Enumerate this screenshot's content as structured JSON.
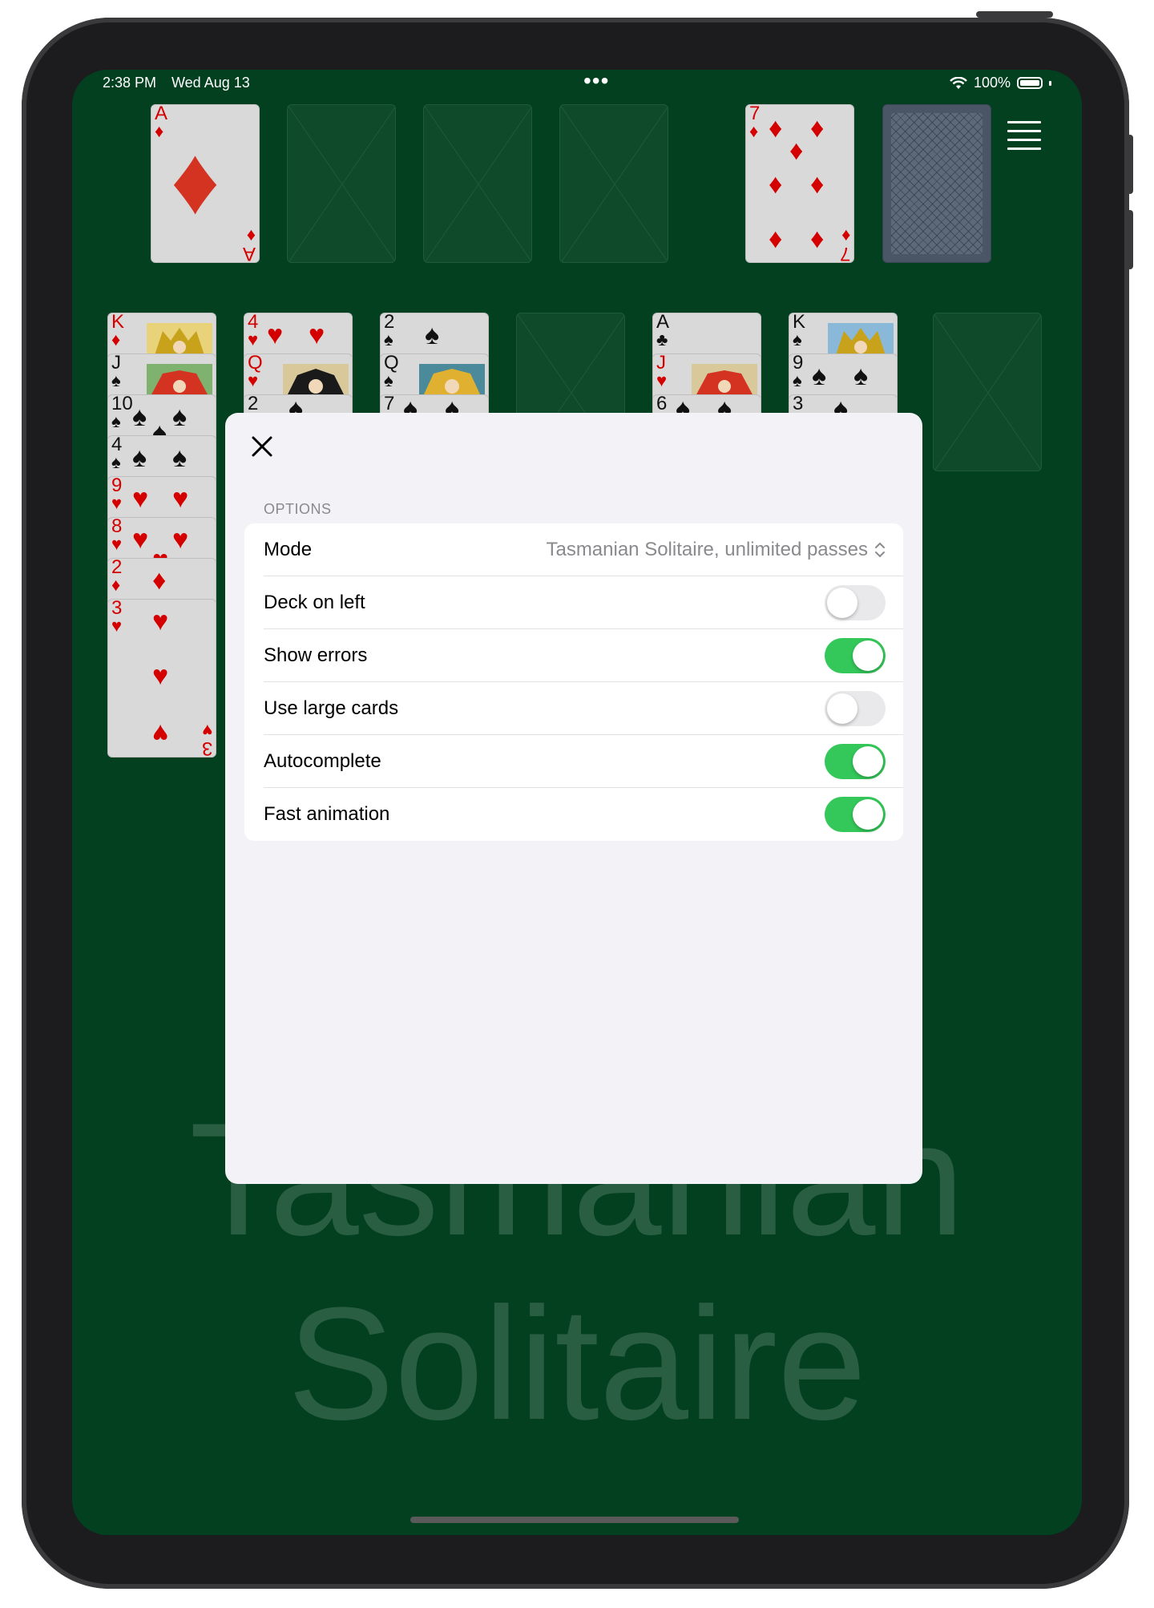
{
  "status_bar": {
    "time": "2:38 PM",
    "date": "Wed Aug 13",
    "more_dots": "•••",
    "battery": "100%"
  },
  "board": {
    "foundation": [
      {
        "rank": "A",
        "suit": "♦",
        "color": "red"
      },
      {
        "empty": true
      },
      {
        "empty": true
      },
      {
        "empty": true
      }
    ],
    "waste_card": {
      "rank": "7",
      "suit": "♦",
      "color": "red"
    },
    "columns": [
      {
        "cards": [
          "K♦",
          "J♠",
          "10♠",
          "4♠",
          "9♥",
          "8♥",
          "2♦",
          "3♥"
        ]
      },
      {
        "cards": [
          "4♥",
          "Q♥",
          "2♠"
        ]
      },
      {
        "cards": [
          "2♠",
          "Q♠",
          "7♠"
        ]
      },
      {
        "cards": []
      },
      {
        "cards": [
          "A♣",
          "J♥",
          "6♠"
        ]
      },
      {
        "cards": [
          "K♠",
          "9♠",
          "3♠"
        ]
      },
      {
        "cards": []
      }
    ]
  },
  "watermark": {
    "line1": "Tasmanian",
    "line2": "Solitaire"
  },
  "options_modal": {
    "close_label": "Close",
    "section_title": "OPTIONS",
    "mode": {
      "label": "Mode",
      "value": "Tasmanian Solitaire, unlimited passes"
    },
    "toggles": [
      {
        "label": "Deck on left",
        "on": false
      },
      {
        "label": "Show errors",
        "on": true
      },
      {
        "label": "Use large cards",
        "on": false
      },
      {
        "label": "Autocomplete",
        "on": true
      },
      {
        "label": "Fast animation",
        "on": true
      }
    ]
  },
  "colors": {
    "table_green": "#024020",
    "toggle_on": "#34c759",
    "card_red": "#d40000"
  }
}
